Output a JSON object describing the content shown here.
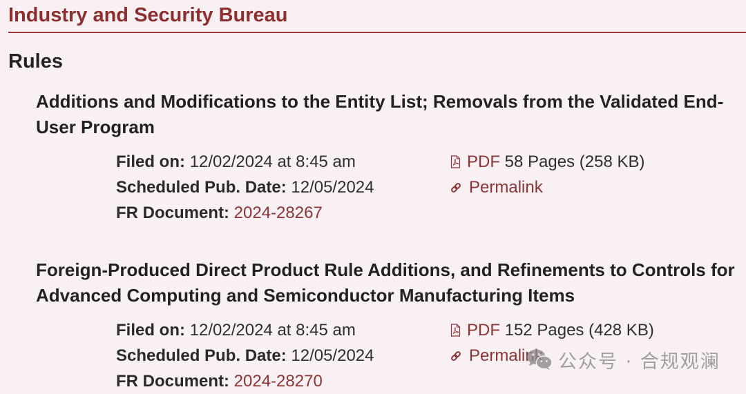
{
  "agency": {
    "name": "Industry and Security Bureau"
  },
  "section": {
    "heading": "Rules"
  },
  "labels": {
    "filed_on": "Filed on:",
    "scheduled_pub_date": "Scheduled Pub. Date:",
    "fr_document": "FR Document:",
    "pdf": "PDF",
    "permalink": "Permalink"
  },
  "documents": [
    {
      "title": "Additions and Modifications to the Entity List; Removals from the Validated End-User Program",
      "filed_on": "12/02/2024 at 8:45 am",
      "scheduled_pub_date": "12/05/2024",
      "fr_document": "2024-28267",
      "pdf_details": "58 Pages (258 KB)"
    },
    {
      "title": "Foreign-Produced Direct Product Rule Additions, and Refinements to Controls for Advanced Computing and Semiconductor Manufacturing Items",
      "filed_on": "12/02/2024 at 8:45 am",
      "scheduled_pub_date": "12/05/2024",
      "fr_document": "2024-28270",
      "pdf_details": "152 Pages (428 KB)"
    }
  ],
  "icons": {
    "pdf": "pdf-file-icon",
    "permalink": "link-icon",
    "watermark": "wechat-icon"
  },
  "colors": {
    "background": "#f9f0f3",
    "agency": "#8e2f2f",
    "rule": "#9b3a3a",
    "heading": "#222222",
    "label": "#2a2a2a",
    "text": "#2e2e2e",
    "link": "#8e3434",
    "watermark": "#8a8a8a"
  },
  "watermark": {
    "text": "公众号 · 合规观澜"
  }
}
